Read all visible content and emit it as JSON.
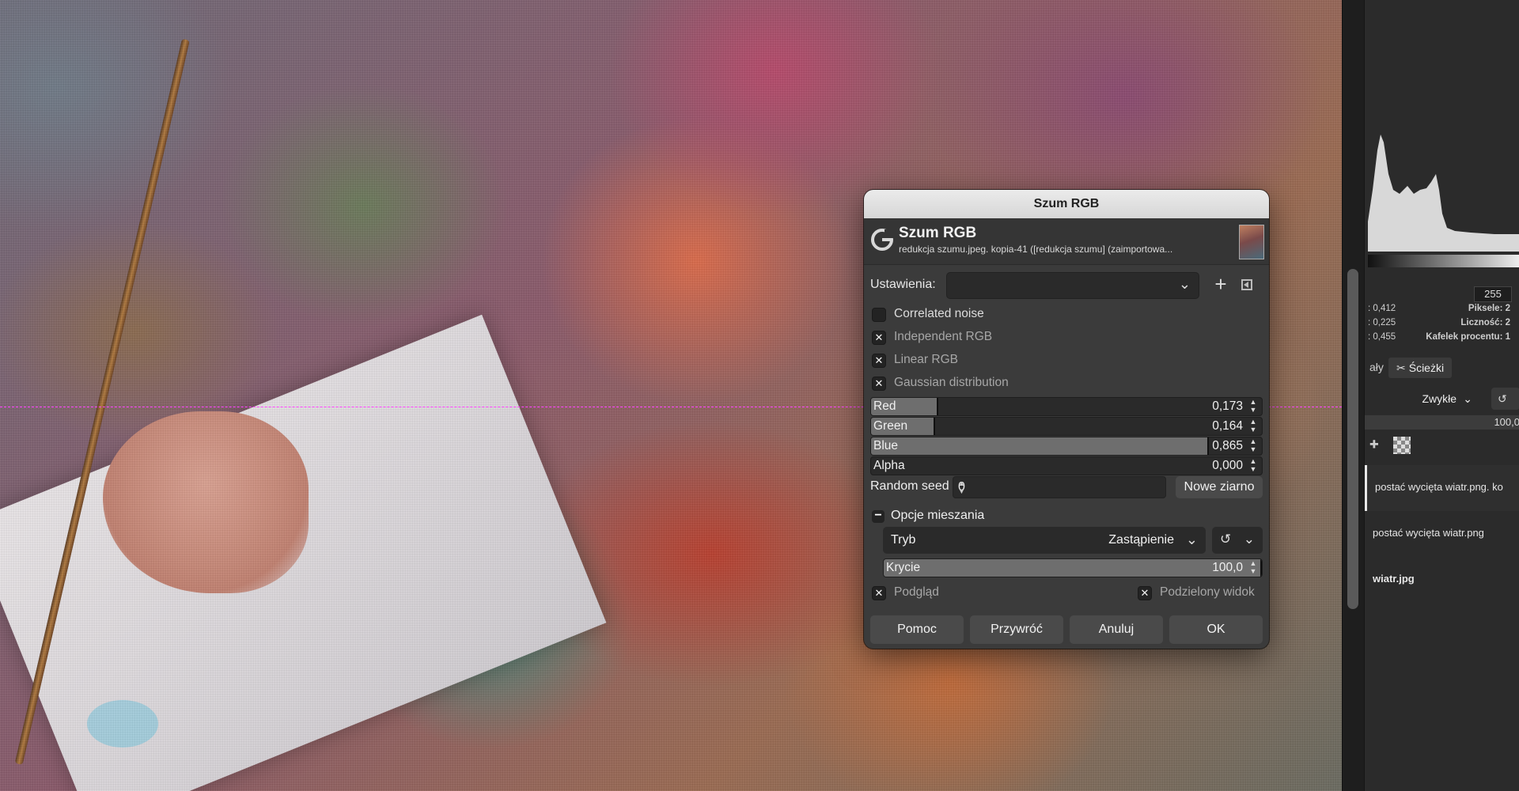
{
  "dialog": {
    "window_title": "Szum RGB",
    "header_title": "Szum RGB",
    "header_subtitle": "redukcja szumu.jpeg. kopia-41 ([redukcja szumu] (zaimportowa...",
    "presets_label": "Ustawienia:",
    "presets_value": "",
    "options": [
      {
        "label": "Correlated noise",
        "checked": false,
        "dim": false
      },
      {
        "label": "Independent RGB",
        "checked": true,
        "dim": true
      },
      {
        "label": "Linear RGB",
        "checked": true,
        "dim": true
      },
      {
        "label": "Gaussian distribution",
        "checked": true,
        "dim": true
      }
    ],
    "sliders": [
      {
        "label": "Red",
        "value": "0,173",
        "fraction": 0.173
      },
      {
        "label": "Green",
        "value": "0,164",
        "fraction": 0.164
      },
      {
        "label": "Blue",
        "value": "0,865",
        "fraction": 0.865
      },
      {
        "label": "Alpha",
        "value": "0,000",
        "fraction": 0.0
      }
    ],
    "seed_label": "Random seed",
    "seed_value": "0",
    "new_seed_label": "Nowe ziarno",
    "blend_section_label": "Opcje mieszania",
    "mode_label": "Tryb",
    "mode_value": "Zastąpienie",
    "opacity_label": "Krycie",
    "opacity_value": "100,0",
    "opacity_fraction": 1.0,
    "preview_label": "Podgląd",
    "split_view_label": "Podzielony widok",
    "buttons": {
      "help": "Pomoc",
      "reset": "Przywróć",
      "cancel": "Anuluj",
      "ok": "OK"
    }
  },
  "dock": {
    "histogram_max": "255",
    "stats": [
      {
        "left": ": 0,412",
        "right": "Piksele: 2"
      },
      {
        "left": ": 0,225",
        "right": "Liczność: 2"
      },
      {
        "left": ": 0,455",
        "right": "Kafelek procentu: 1"
      }
    ],
    "tab_partial": "ały",
    "tab_paths": "Ścieżki",
    "layer_mode": "Zwykłe",
    "layer_opacity": "100,0",
    "layers": [
      {
        "name": "postać wycięta wiatr.png. ko",
        "active": true,
        "bold": false
      },
      {
        "name": "postać wycięta wiatr.png",
        "active": false,
        "bold": false
      },
      {
        "name": "wiatr.jpg",
        "active": false,
        "bold": true
      }
    ]
  },
  "colors": {
    "dialog_bg": "#3b3b3b",
    "slider_fill": "#6e6e6e",
    "split_line": "#ff40ff"
  }
}
